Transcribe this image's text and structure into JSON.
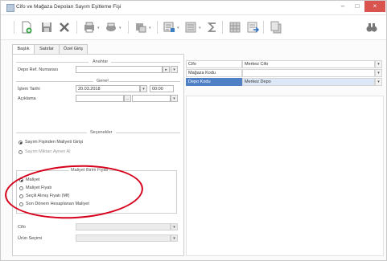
{
  "window": {
    "title": "Cifo ve Mağaza Depoları Sayım Eşitleme Fişi",
    "min_icon": "minimize-icon",
    "max_icon": "maximize-icon",
    "close_icon": "close-icon",
    "min_glyph": "–",
    "max_glyph": "□",
    "close_glyph": "×"
  },
  "toolbar": {
    "icons": [
      "new-document-icon",
      "save-icon",
      "delete-icon",
      "print-preview-icon",
      "print-icon",
      "design-icon",
      "export-icon",
      "list-icon",
      "sum-icon",
      "grid-icon",
      "import-icon",
      "copy-icon",
      "search-binoculars-icon"
    ],
    "dropdown_glyph": "▾"
  },
  "tabs": [
    {
      "label": "Başlık",
      "active": true
    },
    {
      "label": "Satırlar",
      "active": false
    },
    {
      "label": "Özel Giriş",
      "active": false
    }
  ],
  "arastir": {
    "header": "Anahtar",
    "fis_ref_label": "Depo Ref. Numarası",
    "fis_ref_value": "",
    "btn_glyph": "▸"
  },
  "genel": {
    "header": "Genel",
    "date_label": "İşlem Tarihi",
    "date_value": "20.03.2018",
    "time_value": "00:00",
    "date_dd": "▾",
    "desc_label": "Açıklama",
    "desc_value": "",
    "small_glyph": "..."
  },
  "secenekler": {
    "header": "Seçenekler",
    "opt1": "Sayım Fişinden Maliyeti Girişi",
    "opt2": "Sayım Miktarı Aynen Al"
  },
  "maliyet": {
    "header": "Maliyet Birim Fiyatı",
    "options": [
      {
        "label": "Maliyet",
        "selected": true
      },
      {
        "label": "Maliyet Fiyatı",
        "selected": false
      },
      {
        "label": "Seçili Alınış Fiyatı (Mf)",
        "selected": false
      },
      {
        "label": "Son Dönem Hesaplanan Maliyet",
        "selected": false
      }
    ]
  },
  "bottom": {
    "field1_label": "Cifo",
    "field2_label": "Ürün Seçimi",
    "dd": "▾"
  },
  "right": {
    "rows": [
      {
        "label": "Cifo",
        "value": "Merkez Cifo",
        "selected": false
      },
      {
        "label": "Mağaza Kodu",
        "value": "",
        "selected": false
      },
      {
        "label": "Depo Kodu",
        "value": "Merkez Depo",
        "selected": true
      }
    ],
    "dd": "▾"
  }
}
